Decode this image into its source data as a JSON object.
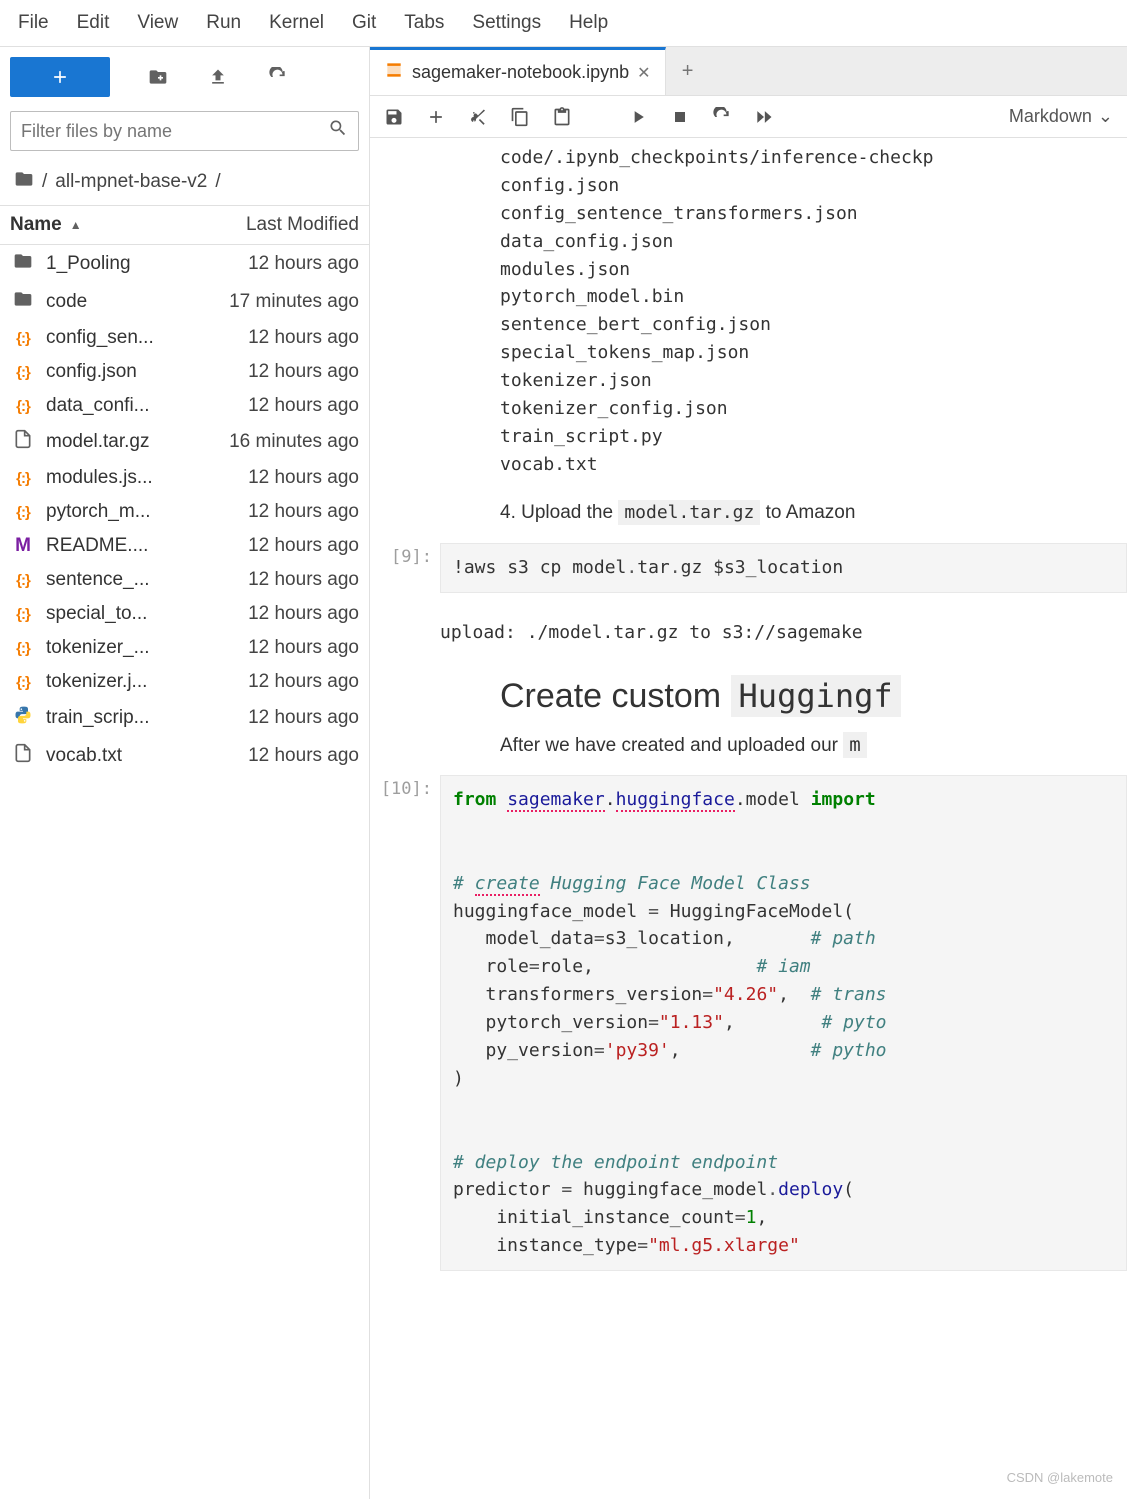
{
  "menubar": [
    "File",
    "Edit",
    "View",
    "Run",
    "Kernel",
    "Git",
    "Tabs",
    "Settings",
    "Help"
  ],
  "sidebar": {
    "filter_placeholder": "Filter files by name",
    "breadcrumb_sep1": "/",
    "breadcrumb_folder": "all-mpnet-base-v2",
    "breadcrumb_sep2": "/",
    "head_name": "Name",
    "head_modified": "Last Modified",
    "files": [
      {
        "icon": "folder",
        "name": "1_Pooling",
        "modified": "12 hours ago"
      },
      {
        "icon": "folder",
        "name": "code",
        "modified": "17 minutes ago"
      },
      {
        "icon": "json",
        "name": "config_sen...",
        "modified": "12 hours ago"
      },
      {
        "icon": "json",
        "name": "config.json",
        "modified": "12 hours ago"
      },
      {
        "icon": "json",
        "name": "data_confi...",
        "modified": "12 hours ago"
      },
      {
        "icon": "file",
        "name": "model.tar.gz",
        "modified": "16 minutes ago"
      },
      {
        "icon": "json",
        "name": "modules.js...",
        "modified": "12 hours ago"
      },
      {
        "icon": "json",
        "name": "pytorch_m...",
        "modified": "12 hours ago"
      },
      {
        "icon": "md",
        "name": "README....",
        "modified": "12 hours ago"
      },
      {
        "icon": "json",
        "name": "sentence_...",
        "modified": "12 hours ago"
      },
      {
        "icon": "json",
        "name": "special_to...",
        "modified": "12 hours ago"
      },
      {
        "icon": "json",
        "name": "tokenizer_...",
        "modified": "12 hours ago"
      },
      {
        "icon": "json",
        "name": "tokenizer.j...",
        "modified": "12 hours ago"
      },
      {
        "icon": "py",
        "name": "train_scrip...",
        "modified": "12 hours ago"
      },
      {
        "icon": "file",
        "name": "vocab.txt",
        "modified": "12 hours ago"
      }
    ]
  },
  "tab": {
    "title": "sagemaker-notebook.ipynb"
  },
  "celltype": "Markdown",
  "output_files": "code/.ipynb_checkpoints/inference-checkp\nconfig.json\nconfig_sentence_transformers.json\ndata_config.json\nmodules.json\npytorch_model.bin\nsentence_bert_config.json\nspecial_tokens_map.json\ntokenizer.json\ntokenizer_config.json\ntrain_script.py\nvocab.txt",
  "step4_prefix": "4. Upload the ",
  "step4_code": "model.tar.gz",
  "step4_suffix": " to Amazon",
  "cell9": {
    "prompt": "[9]:",
    "bang": "!",
    "cmd": "aws s3 cp model",
    "dot1": ".",
    "tar": "tar",
    "dot2": ".",
    "gz": "gz $s3_location",
    "output": "upload: ./model.tar.gz to s3://sagemake"
  },
  "heading": {
    "pre": "Create custom ",
    "code": "Huggingf"
  },
  "para": {
    "text": "After we have created and uploaded our ",
    "code": "m"
  },
  "cell10": {
    "prompt": "[10]:",
    "l1_from": "from",
    "l1_mod1": "sagemaker",
    "l1_dot": ".",
    "l1_mod2": "huggingface",
    "l1_dot2": ".",
    "l1_mod3": "model",
    "l1_import": "import",
    "c1": "# ",
    "c1b": "create",
    "c1c": " Hugging Face Model Class",
    "l2": "huggingface_model ",
    "l2op": "=",
    "l2b": " HuggingFaceModel(",
    "l3a": "   model_data",
    "l3op": "=",
    "l3b": "s3_location,       ",
    "l3c": "# path",
    "l4a": "   role",
    "l4op": "=",
    "l4b": "role,               ",
    "l4c": "# iam ",
    "l5a": "   transformers_version",
    "l5op": "=",
    "l5s": "\"4.26\"",
    "l5b": ",  ",
    "l5c": "# trans",
    "l6a": "   pytorch_version",
    "l6op": "=",
    "l6s": "\"1.13\"",
    "l6b": ",        ",
    "l6c": "# pyto",
    "l7a": "   py_version",
    "l7op": "=",
    "l7s": "'py39'",
    "l7b": ",            ",
    "l7c": "# pytho",
    "l8": ")",
    "c2": "# deploy the endpoint endpoint",
    "l9a": "predictor ",
    "l9op": "=",
    "l9b": " huggingface_model",
    "l9dot": ".",
    "l9c": "deploy",
    "l9d": "(",
    "l10a": "    initial_instance_count",
    "l10op": "=",
    "l10n": "1",
    "l10b": ",",
    "l11a": "    instance_type",
    "l11op": "=",
    "l11s": "\"ml.g5.xlarge\""
  },
  "watermark": "CSDN @lakemote"
}
